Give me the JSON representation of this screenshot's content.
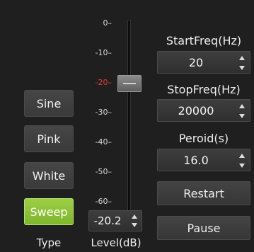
{
  "type_buttons": [
    {
      "label": "Sine",
      "active": false
    },
    {
      "label": "Pink",
      "active": false
    },
    {
      "label": "White",
      "active": false
    },
    {
      "label": "Sweep",
      "active": true
    }
  ],
  "type_label": "Type",
  "level": {
    "ticks": [
      "0",
      "-10",
      "-20",
      "-30",
      "-40",
      "-50",
      "-60"
    ],
    "highlight_tick": "-20",
    "value": "-20.2",
    "label": "Level(dB)"
  },
  "start_freq": {
    "label": "StartFreq(Hz)",
    "value": "20"
  },
  "stop_freq": {
    "label": "StopFreq(Hz)",
    "value": "20000"
  },
  "period": {
    "label": "Peroid(s)",
    "value": "16.0"
  },
  "actions": {
    "restart": "Restart",
    "pause": "Pause"
  },
  "colors": {
    "background": "#1f1f1f",
    "active_button": "#8cc43a",
    "highlight_tick": "#e8412c"
  }
}
